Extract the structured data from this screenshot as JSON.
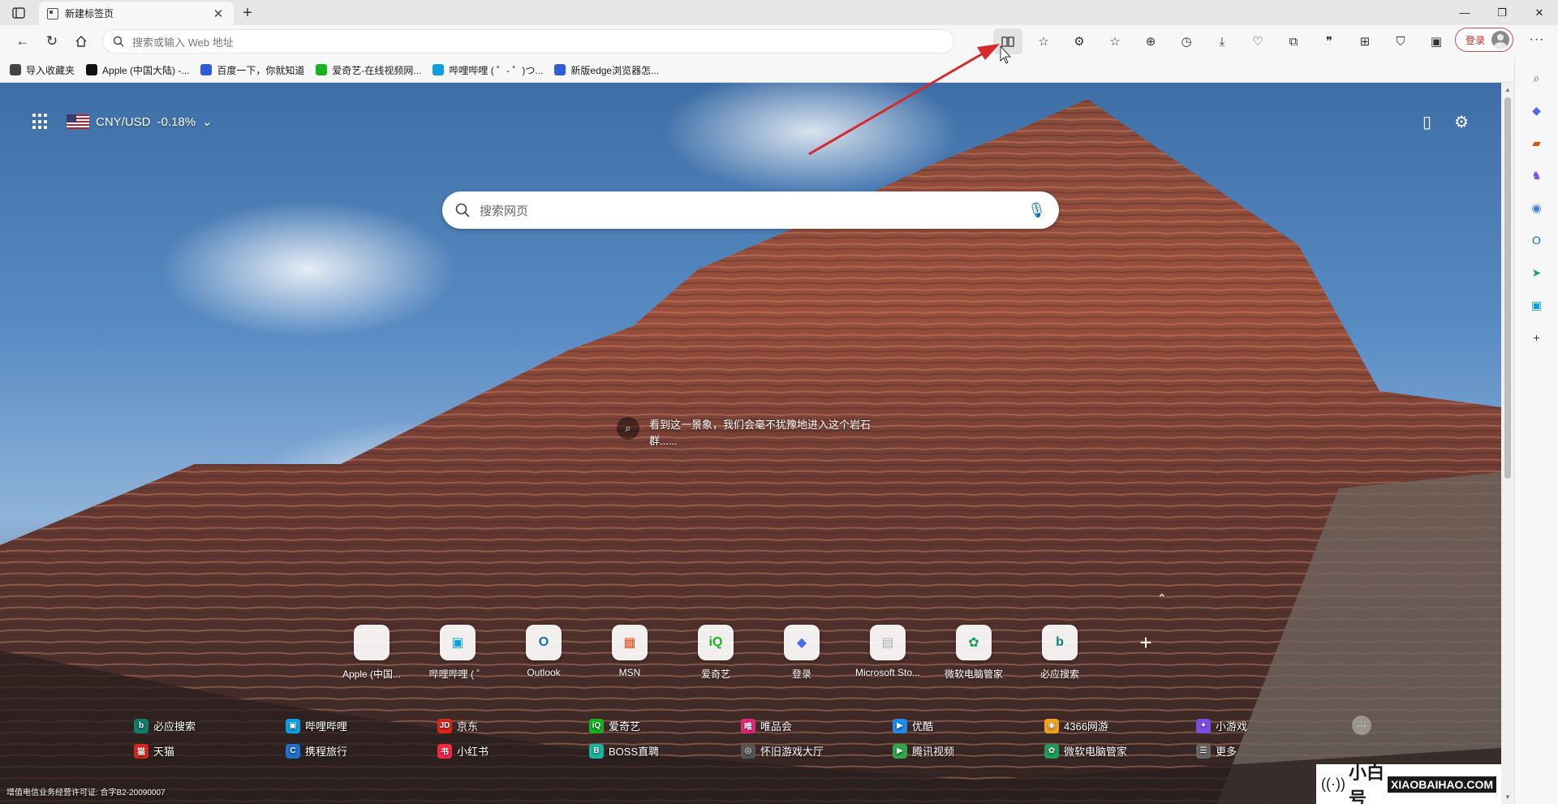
{
  "tabbar": {
    "active_tab_title": "新建标签页",
    "new_tab_symbol": "+"
  },
  "toolbar": {
    "address_placeholder": "搜索或输入 Web 地址",
    "login_label": "登录",
    "icons": [
      "read-aloud-icon",
      "add-favorite-icon",
      "extensions-icon",
      "favorites-icon",
      "collections-icon",
      "history-icon",
      "downloads-icon",
      "browser-essentials-icon",
      "screenshot-icon",
      "quotes-icon",
      "apps-icon",
      "performance-icon",
      "sidebar-icon"
    ]
  },
  "bookmarks": [
    {
      "label": "导入收藏夹",
      "icon": "import-icon",
      "color": "#444444"
    },
    {
      "label": "Apple (中国大陆) -...",
      "icon": "apple-icon",
      "color": "#111111"
    },
    {
      "label": "百度一下，你就知道",
      "icon": "baidu-icon",
      "color": "#2f5dda"
    },
    {
      "label": "爱奇艺-在线视频网...",
      "icon": "iqiyi-icon",
      "color": "#14b51e"
    },
    {
      "label": "哔哩哔哩 ( ゜- ゜)つ...",
      "icon": "bilibili-icon",
      "color": "#0aa0e6"
    },
    {
      "label": "新版edge浏览器怎...",
      "icon": "baidu-icon",
      "color": "#2f5dda"
    }
  ],
  "ntp": {
    "currency_label": "CNY/USD",
    "currency_change": "-0.18%",
    "search_placeholder": "搜索网页",
    "caption_text": "看到这一景象，我们会毫不犹豫地进入这个岩石群......"
  },
  "quick_links": [
    {
      "label": "Apple (中国...",
      "glyph": "",
      "color": "#111111"
    },
    {
      "label": "哔哩哔哩 ( ゜",
      "glyph": "▣",
      "color": "#0aa0e6"
    },
    {
      "label": "Outlook",
      "glyph": "O",
      "color": "#0f6cbd"
    },
    {
      "label": "MSN",
      "glyph": "▦",
      "color": "#f25022"
    },
    {
      "label": "爱奇艺",
      "glyph": "iQ",
      "color": "#14b51e"
    },
    {
      "label": "登录",
      "glyph": "◆",
      "color": "#4f6bed"
    },
    {
      "label": "Microsoft Sto...",
      "glyph": "▤",
      "color": "#b0b0b0"
    },
    {
      "label": "微软电脑管家",
      "glyph": "✿",
      "color": "#1e9e5a"
    },
    {
      "label": "必应搜索",
      "glyph": "b",
      "color": "#0f7c6c"
    }
  ],
  "sites": [
    {
      "label": "必应搜索",
      "color": "#0f7c6c",
      "glyph": "b"
    },
    {
      "label": "哔哩哔哩",
      "color": "#0aa0e6",
      "glyph": "▣"
    },
    {
      "label": "京东",
      "color": "#e1251b",
      "glyph": "JD"
    },
    {
      "label": "爱奇艺",
      "color": "#14b51e",
      "glyph": "iQ"
    },
    {
      "label": "唯品会",
      "color": "#e6287a",
      "glyph": "唯"
    },
    {
      "label": "优酷",
      "color": "#1f8ceb",
      "glyph": "▶"
    },
    {
      "label": "4366网游",
      "color": "#f2a31b",
      "glyph": "◉"
    },
    {
      "label": "小游戏",
      "color": "#7b4de0",
      "glyph": "✦"
    },
    {
      "label": "天猫",
      "color": "#e1251b",
      "glyph": "猫"
    },
    {
      "label": "携程旅行",
      "color": "#1f6fd1",
      "glyph": "C"
    },
    {
      "label": "小红书",
      "color": "#ff2442",
      "glyph": "书"
    },
    {
      "label": "BOSS直聘",
      "color": "#19b79f",
      "glyph": "B"
    },
    {
      "label": "怀旧游戏大厅",
      "color": "#555555",
      "glyph": "◎"
    },
    {
      "label": "腾讯视频",
      "color": "#2eaa4a",
      "glyph": "▶"
    },
    {
      "label": "微软电脑管家",
      "color": "#1e9e5a",
      "glyph": "✿"
    },
    {
      "label": "更多",
      "color": "#666666",
      "glyph": "☰"
    }
  ],
  "footer": {
    "license_text": "增值电信业务经营许可证: 合字B2-20090007"
  },
  "watermark": {
    "cn": "小白号",
    "en": "XIAOBAIHAO.COM"
  }
}
